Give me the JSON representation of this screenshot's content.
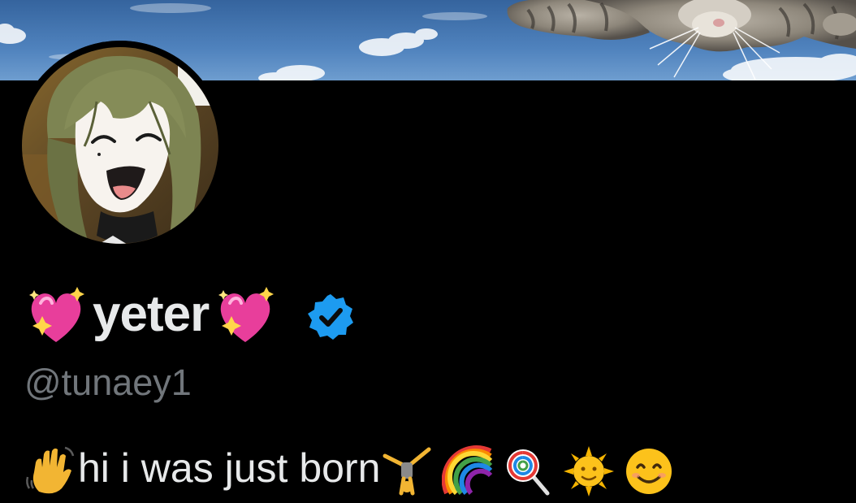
{
  "profile": {
    "display_name": "yeter",
    "handle": "@tunaey1",
    "bio": "hi i was just born",
    "verified": true
  },
  "icons": {
    "name_prefix": "sparkling-heart-icon",
    "name_suffix": "sparkling-heart-icon",
    "verified": "verified-badge-icon",
    "bio_prefix": "waving-hand-icon",
    "bio_suffix": [
      "person-cartwheeling-icon",
      "rainbow-icon",
      "lollipop-icon",
      "sun-with-face-icon",
      "smiling-face-icon"
    ]
  },
  "colors": {
    "background": "#000000",
    "primary_text": "#e7e9ea",
    "secondary_text": "#71767b",
    "verified_blue": "#1d9bf0",
    "heart_pink": "#e83e9b"
  }
}
